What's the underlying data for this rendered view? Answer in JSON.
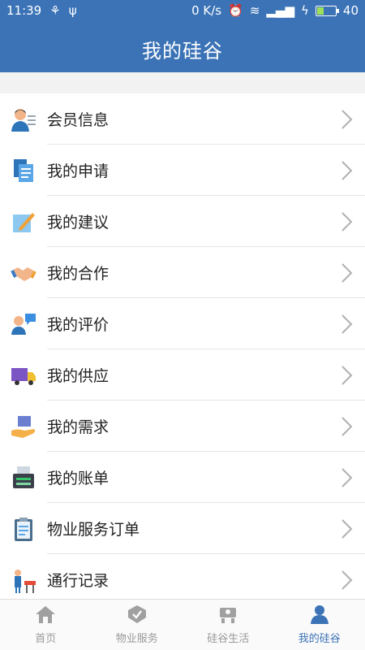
{
  "status": {
    "time": "11:39",
    "speed": "0 K/s",
    "battery": "40",
    "battery_fraction": 0.4
  },
  "header": {
    "title": "我的硅谷"
  },
  "menu": [
    {
      "label": "会员信息",
      "icon": "member-info-icon"
    },
    {
      "label": "我的申请",
      "icon": "document-icon"
    },
    {
      "label": "我的建议",
      "icon": "edit-note-icon"
    },
    {
      "label": "我的合作",
      "icon": "handshake-icon"
    },
    {
      "label": "我的评价",
      "icon": "comment-user-icon"
    },
    {
      "label": "我的供应",
      "icon": "truck-icon"
    },
    {
      "label": "我的需求",
      "icon": "hand-box-icon"
    },
    {
      "label": "我的账单",
      "icon": "bill-printer-icon"
    },
    {
      "label": "物业服务订单",
      "icon": "clipboard-icon"
    },
    {
      "label": "通行记录",
      "icon": "access-gate-icon"
    }
  ],
  "tabs": [
    {
      "label": "首页",
      "icon": "home-icon",
      "active": false
    },
    {
      "label": "物业服务",
      "icon": "property-service-icon",
      "active": false
    },
    {
      "label": "硅谷生活",
      "icon": "life-icon",
      "active": false
    },
    {
      "label": "我的硅谷",
      "icon": "user-icon",
      "active": true
    }
  ],
  "colors": {
    "primary": "#3b73b6",
    "tab_inactive": "#9a9a9a"
  }
}
